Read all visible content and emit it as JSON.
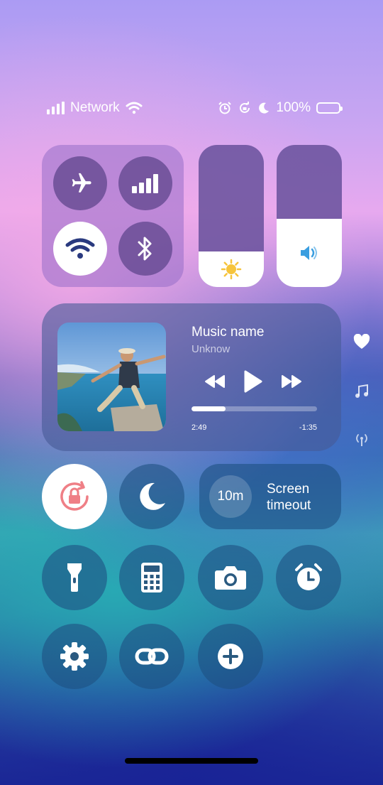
{
  "status_bar": {
    "network_label": "Network",
    "battery_label": "100%",
    "icons": [
      "signal-icon",
      "wifi-icon",
      "alarm-icon",
      "rotation-lock-icon",
      "moon-icon",
      "battery-icon"
    ]
  },
  "connectivity": {
    "airplane": {
      "icon": "airplane-icon",
      "state": "off"
    },
    "cellular": {
      "icon": "cellular-icon",
      "state": "off"
    },
    "wifi": {
      "icon": "wifi-icon",
      "state": "on"
    },
    "bluetooth": {
      "icon": "bluetooth-icon",
      "state": "off"
    }
  },
  "sliders": {
    "brightness": {
      "icon": "sun-icon",
      "level": 0.25
    },
    "volume": {
      "icon": "speaker-icon",
      "level": 0.48
    }
  },
  "media": {
    "title": "Music name",
    "artist": "Unknow",
    "elapsed": "2:49",
    "remaining": "-1:35",
    "progress": 0.27,
    "controls": [
      "rewind-icon",
      "play-icon",
      "fast-forward-icon"
    ]
  },
  "side_icons": [
    "heart-icon",
    "music-note-icon",
    "broadcast-icon"
  ],
  "toggles": {
    "rotation_lock": {
      "icon": "rotation-lock-icon",
      "state": "on",
      "color": "#ef7f86"
    },
    "do_not_disturb": {
      "icon": "moon-icon",
      "state": "off"
    }
  },
  "screen_timeout": {
    "value": "10m",
    "label": "Screen timeout"
  },
  "shortcuts": [
    {
      "icon": "flashlight-icon"
    },
    {
      "icon": "calculator-icon"
    },
    {
      "icon": "camera-icon"
    },
    {
      "icon": "alarm-clock-icon"
    },
    {
      "icon": "settings-icon"
    },
    {
      "icon": "link-icon"
    },
    {
      "icon": "add-icon"
    }
  ],
  "colors": {
    "wifi_active": "#2a3a7f",
    "volume_icon": "#3a9ee0",
    "sun": "#f6c43c",
    "lock_red": "#ef7f86"
  }
}
